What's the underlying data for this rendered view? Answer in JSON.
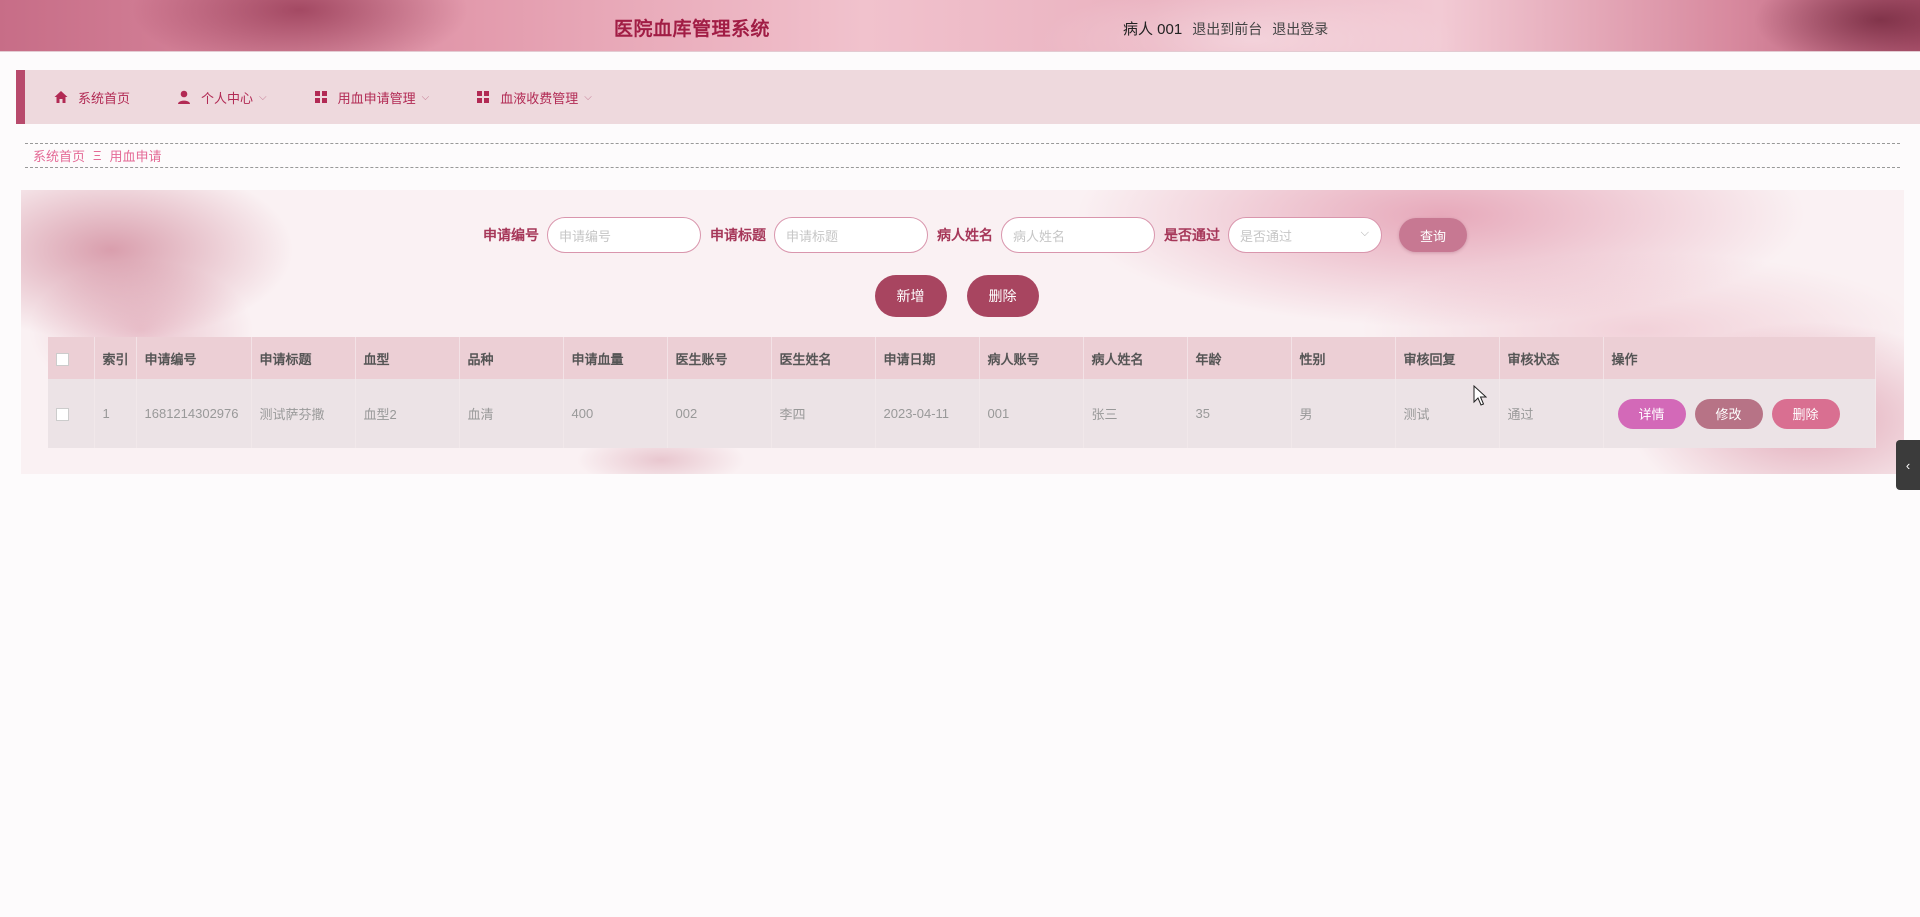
{
  "header": {
    "title": "医院血库管理系统",
    "user_name": "病人 001",
    "back_to_front": "退出到前台",
    "logout": "退出登录"
  },
  "nav": {
    "items": [
      {
        "label": "系统首页",
        "icon": "home-icon"
      },
      {
        "label": "个人中心",
        "icon": "user-icon"
      },
      {
        "label": "用血申请管理",
        "icon": "grid-icon"
      },
      {
        "label": "血液收费管理",
        "icon": "grid-icon"
      }
    ]
  },
  "breadcrumb": {
    "home": "系统首页",
    "separator": "Ξ",
    "current": "用血申请"
  },
  "search": {
    "fields": [
      {
        "label": "申请编号",
        "placeholder": "申请编号"
      },
      {
        "label": "申请标题",
        "placeholder": "申请标题"
      },
      {
        "label": "病人姓名",
        "placeholder": "病人姓名"
      },
      {
        "label": "是否通过",
        "placeholder": "是否通过"
      }
    ],
    "query_button": "查询"
  },
  "actions": {
    "add": "新增",
    "delete": "删除"
  },
  "table": {
    "headers": [
      "索引",
      "申请编号",
      "申请标题",
      "血型",
      "品种",
      "申请血量",
      "医生账号",
      "医生姓名",
      "申请日期",
      "病人账号",
      "病人姓名",
      "年龄",
      "性别",
      "审核回复",
      "审核状态",
      "操作"
    ],
    "rows": [
      {
        "index": "1",
        "app_no": "1681214302976",
        "title": "测试萨芬撒",
        "blood_type": "血型2",
        "variety": "血清",
        "volume": "400",
        "doctor_account": "002",
        "doctor_name": "李四",
        "date": "2023-04-11",
        "patient_account": "001",
        "patient_name": "张三",
        "age": "35",
        "gender": "男",
        "review_reply": "测试",
        "review_status": "通过",
        "ops": {
          "detail": "详情",
          "edit": "修改",
          "remove": "删除"
        }
      }
    ]
  },
  "side_tab": {
    "icon": "chevron-left-icon",
    "glyph": "‹"
  },
  "colors": {
    "brand": "#a11d45",
    "nav_bg": "#eed9dd",
    "nav_accent": "#b84a6c",
    "button_primary": "#a84560",
    "detail_button": "#d369b8",
    "edit_button": "#b77386",
    "remove_button": "#d96f91"
  }
}
